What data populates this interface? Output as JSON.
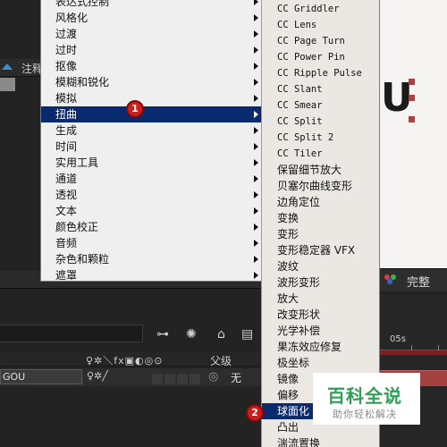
{
  "main_menu": {
    "items": [
      {
        "label": "表达式控制",
        "submenu": true
      },
      {
        "label": "风格化",
        "submenu": true
      },
      {
        "label": "过渡",
        "submenu": true
      },
      {
        "label": "过时",
        "submenu": true
      },
      {
        "label": "抠像",
        "submenu": true
      },
      {
        "label": "模糊和锐化",
        "submenu": true
      },
      {
        "label": "模拟",
        "submenu": true
      },
      {
        "label": "扭曲",
        "submenu": true,
        "highlighted": true
      },
      {
        "label": "生成",
        "submenu": true
      },
      {
        "label": "时间",
        "submenu": true
      },
      {
        "label": "实用工具",
        "submenu": true
      },
      {
        "label": "通道",
        "submenu": true
      },
      {
        "label": "透视",
        "submenu": true
      },
      {
        "label": "文本",
        "submenu": true
      },
      {
        "label": "颜色校正",
        "submenu": true
      },
      {
        "label": "音频",
        "submenu": true
      },
      {
        "label": "杂色和颗粒",
        "submenu": true
      },
      {
        "label": "遮罩",
        "submenu": true
      }
    ]
  },
  "sub_menu": {
    "items": [
      {
        "label": "CC Griddler",
        "mono": true
      },
      {
        "label": "CC Lens",
        "mono": true
      },
      {
        "label": "CC Page Turn",
        "mono": true
      },
      {
        "label": "CC Power Pin",
        "mono": true
      },
      {
        "label": "CC Ripple Pulse",
        "mono": true
      },
      {
        "label": "CC Slant",
        "mono": true
      },
      {
        "label": "CC Smear",
        "mono": true
      },
      {
        "label": "CC Split",
        "mono": true
      },
      {
        "label": "CC Split 2",
        "mono": true
      },
      {
        "label": "CC Tiler",
        "mono": true
      },
      {
        "label": "保留细节放大"
      },
      {
        "label": "贝塞尔曲线变形"
      },
      {
        "label": "边角定位"
      },
      {
        "label": "变换"
      },
      {
        "label": "变形"
      },
      {
        "label": "变形稳定器 VFX"
      },
      {
        "label": "波纹"
      },
      {
        "label": "波形变形"
      },
      {
        "label": "放大"
      },
      {
        "label": "改变形状"
      },
      {
        "label": "光学补偿"
      },
      {
        "label": "果冻效应修复"
      },
      {
        "label": "极坐标"
      },
      {
        "label": "镜像"
      },
      {
        "label": "偏移"
      },
      {
        "label": "球面化",
        "highlighted": true
      },
      {
        "label": "凸出"
      },
      {
        "label": "湍流置换"
      }
    ]
  },
  "steps": {
    "step1": "1",
    "step2": "2"
  },
  "background": {
    "tab_label": "注释",
    "preview_letter": "U",
    "panel_label": "完整",
    "time_marker": "05s",
    "parent_header": "父级",
    "layer_name": "GOU",
    "parent_value": "无"
  },
  "watermark": {
    "title": "百科全说",
    "subtitle": "助你轻松解决"
  },
  "colors": {
    "highlight": "#0a2a6e",
    "menu_bg": "#efefef",
    "step_marker": "#d11c1c",
    "watermark_green": "#2f9e55"
  }
}
